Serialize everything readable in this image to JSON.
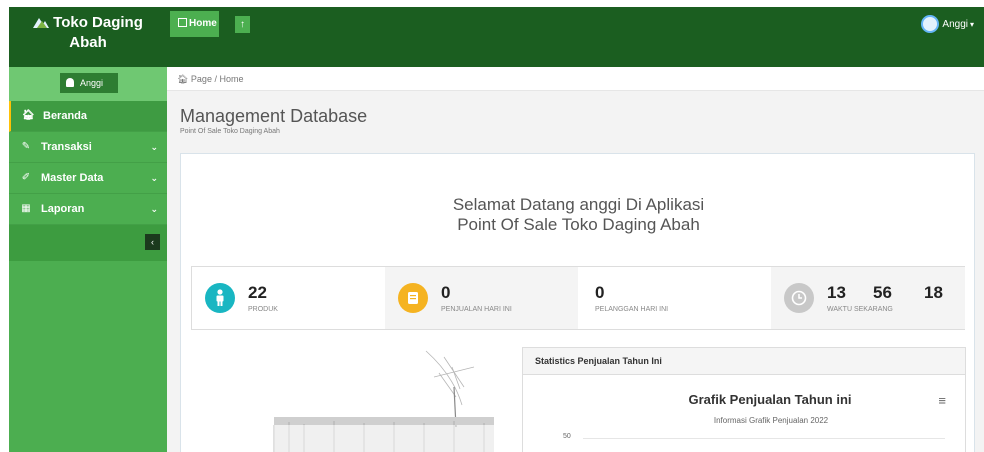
{
  "brand": {
    "line1": "Toko Daging",
    "line2": "Abah"
  },
  "topbar": {
    "home_label": "Home",
    "upload_label": "↑",
    "user_name": "Anggi",
    "user_caret": "▾"
  },
  "sidebar": {
    "user_badge": "Anggi",
    "items": [
      {
        "label": "Beranda",
        "icon": "🏠︎",
        "active": true
      },
      {
        "label": "Transaksi",
        "icon": "✎",
        "chevron": "⌄"
      },
      {
        "label": "Master Data",
        "icon": "✐",
        "chevron": "⌄"
      },
      {
        "label": "Laporan",
        "icon": "▦",
        "chevron": "⌄"
      }
    ],
    "collapse_label": "‹"
  },
  "breadcrumb": {
    "text": "🏠︎ Page  /  Home"
  },
  "page": {
    "title": "Management Database",
    "subtitle": "Point Of Sale Toko Daging Abah",
    "welcome_line1": "Selamat Datang anggi Di Aplikasi",
    "welcome_line2": "Point Of Sale Toko Daging Abah"
  },
  "stats": [
    {
      "value": "22",
      "label": "PRODUK",
      "icon_color": "#19b6c2"
    },
    {
      "value": "0",
      "label": "PENJUALAN HARI INI",
      "icon_color": "#f5b321"
    },
    {
      "value": "0",
      "label": "PELANGGAN HARI INI"
    },
    {
      "hours": "13",
      "minutes": "56",
      "seconds": "18",
      "label": "WAKTU SEKARANG",
      "icon_color": "#c8c8c8"
    }
  ],
  "chart_panel": {
    "header": "Statistics Penjualan Tahun Ini",
    "title": "Grafik Penjualan Tahun ini",
    "subtitle": "Informasi Grafik Penjualan 2022",
    "menu_icon": "≡",
    "y_tick": "50"
  },
  "colors": {
    "topbar": "#1b5e20",
    "sidebar": "#4cae50",
    "accent": "#4caf50"
  }
}
